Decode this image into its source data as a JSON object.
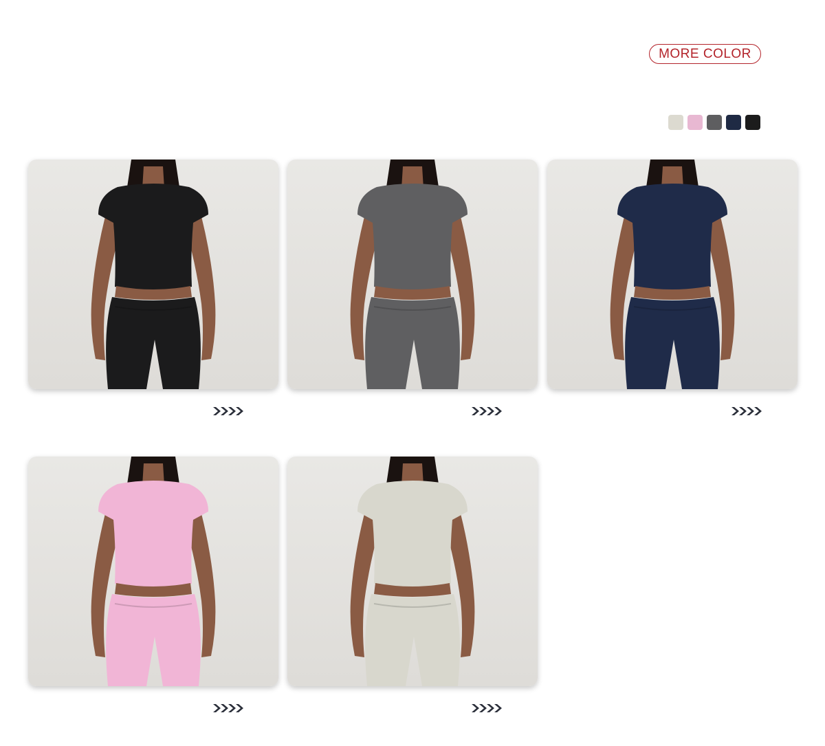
{
  "header": {
    "more_color_label": "MORE COLOR"
  },
  "swatches": [
    {
      "name": "beige",
      "color": "#dcdad0"
    },
    {
      "name": "pink",
      "color": "#e8b8d2"
    },
    {
      "name": "grey",
      "color": "#5e5e60"
    },
    {
      "name": "navy",
      "color": "#1f2a44"
    },
    {
      "name": "black",
      "color": "#1c1c1c"
    }
  ],
  "products": [
    {
      "name": "black",
      "color": "#1b1b1c"
    },
    {
      "name": "grey",
      "color": "#5f5f61"
    },
    {
      "name": "navy",
      "color": "#1f2b49"
    },
    {
      "name": "pink",
      "color": "#f1b5d6"
    },
    {
      "name": "beige",
      "color": "#d8d7cd"
    }
  ],
  "colors": {
    "accent": "#b3232a",
    "arrow": "#2b2f3a",
    "skin": "#8a5b44"
  },
  "icons": {
    "more_arrow": "chevrons-right-icon"
  }
}
